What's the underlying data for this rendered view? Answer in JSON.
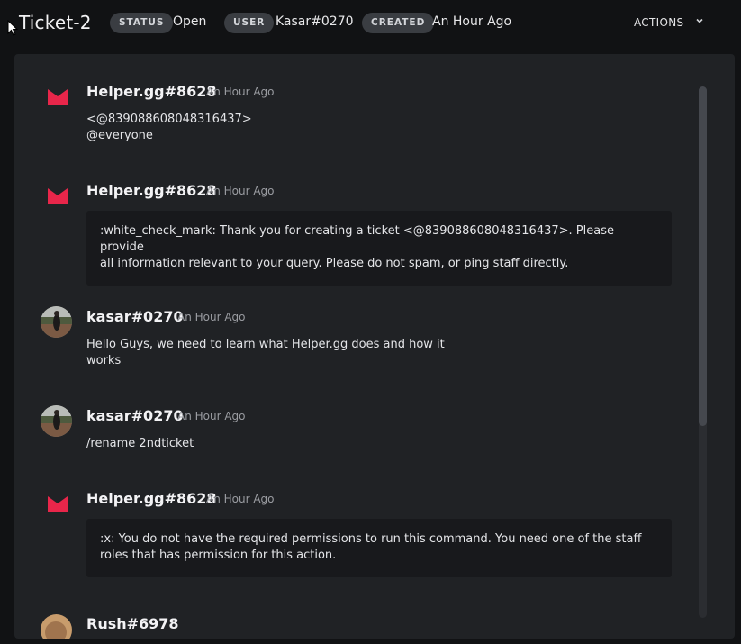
{
  "header": {
    "title": "Ticket-2",
    "status_label": "STATUS",
    "status_value": "Open",
    "user_label": "USER",
    "user_value": "Kasar#0270",
    "created_label": "CREATED",
    "created_value": "An Hour Ago",
    "actions_label": "ACTIONS"
  },
  "colors": {
    "brand": "#e8264a",
    "panel": "#202225",
    "embed": "#18191c",
    "pill": "#3a3d42"
  },
  "messages": [
    {
      "author": "Helper.gg#8628",
      "time": "An Hour Ago",
      "line1": "<@839088608048316437>",
      "line2": "@everyone",
      "avatar": "helper-logo-icon"
    },
    {
      "author": "Helper.gg#8628",
      "time": "An Hour Ago",
      "embed_line1": ":white_check_mark: Thank you for creating a ticket <@839088608048316437>. Please provide",
      "embed_line2": "all information relevant to your query. Please do not spam, or ping staff directly.",
      "avatar": "helper-logo-icon"
    },
    {
      "author": "kasar#0270",
      "time": "An Hour Ago",
      "line1": "Hello Guys, we need to learn what Helper.gg does and how it",
      "line2": "works",
      "avatar": "user-photo-avatar"
    },
    {
      "author": "kasar#0270",
      "time": "An Hour Ago",
      "line1": "/rename 2ndticket",
      "avatar": "user-photo-avatar"
    },
    {
      "author": "Helper.gg#8628",
      "time": "An Hour Ago",
      "embed_line1": ":x: You do not have the required permissions to run this command. You need one of the staff",
      "embed_line2": "roles that has permission for this action.",
      "avatar": "helper-logo-icon"
    },
    {
      "author": "Rush#6978",
      "avatar": "user-photo-avatar"
    }
  ]
}
